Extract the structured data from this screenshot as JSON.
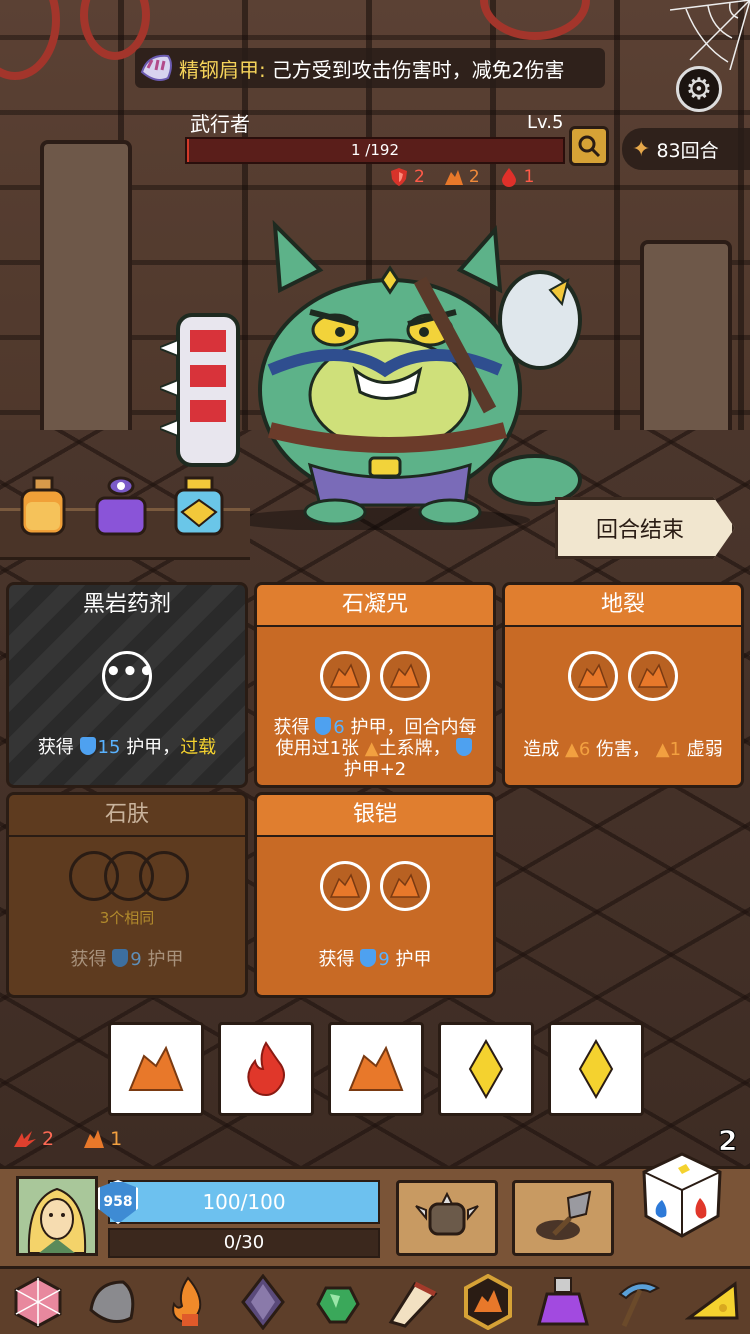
{
  "relic_banner": {
    "name": "精钢肩甲:",
    "effect": "己方受到攻击伤害时，减免2伤害"
  },
  "enemy": {
    "name": "武行者",
    "level": "Lv.5",
    "hp_text": "1 /192",
    "hp_fraction": 0.005,
    "intents": [
      {
        "icon": "shield-icon",
        "value": "2"
      },
      {
        "icon": "earth-icon",
        "value": "2"
      },
      {
        "icon": "blood-drop-icon",
        "value": "1"
      }
    ]
  },
  "rounds": "83回合",
  "end_turn_label": "回合结束",
  "cards": {
    "c1": {
      "title": "黑岩药剂",
      "desc_pre": "获得",
      "desc_num": "15",
      "desc_mid": "护甲，",
      "desc_tag": "过载"
    },
    "c2": {
      "title": "石凝咒",
      "line1_pre": "获得",
      "line1_num": "6",
      "line1_post": "护甲，回合内每",
      "line2_pre": "使用过1张",
      "line2_post": "土系牌，",
      "line3": "护甲+2"
    },
    "c3": {
      "title": "地裂",
      "desc_pre": "造成",
      "desc_num": "6",
      "desc_mid": "伤害，",
      "desc_num2": "1",
      "desc_post": "虚弱"
    },
    "c4": {
      "title": "石肤",
      "condition": "3个相同",
      "desc_pre": "获得",
      "desc_num": "9",
      "desc_post": "护甲"
    },
    "c5": {
      "title": "银铠",
      "desc_pre": "获得",
      "desc_num": "9",
      "desc_post": "护甲"
    }
  },
  "dice": [
    "earth-icon",
    "fire-icon",
    "earth-icon",
    "lightning-diamond-icon",
    "lightning-diamond-icon"
  ],
  "resources": {
    "fury": "2",
    "earth": "1"
  },
  "rerolls": "2",
  "player": {
    "armor": "958",
    "hp_text": "100/100",
    "hp_fraction": 1.0,
    "xp_text": "0/30"
  },
  "colors": {
    "card_orange": "#e07e2f",
    "hp_red": "#d33a2a",
    "player_hp": "#6dc1ef",
    "accent_yellow": "#f4d22f"
  }
}
